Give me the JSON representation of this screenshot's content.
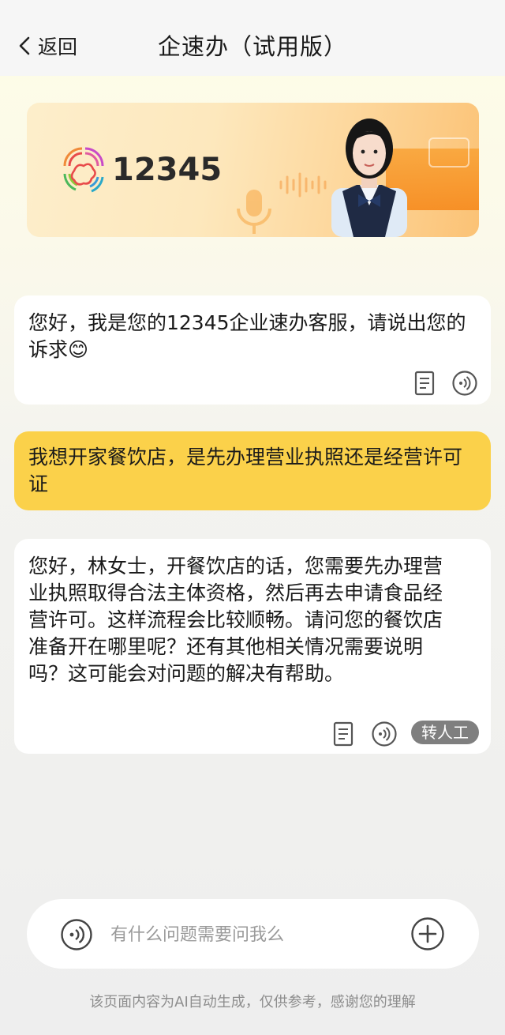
{
  "header": {
    "back_label": "返回",
    "title": "企速办（试用版）"
  },
  "banner": {
    "logo_text": "12345"
  },
  "messages": [
    {
      "role": "bot",
      "text": "您好，我是您的12345企业速办客服，请说出您的诉求😊"
    },
    {
      "role": "user",
      "text": "我想开家餐饮店，是先办理营业执照还是经营许可证"
    },
    {
      "role": "bot",
      "text": "您好，林女士，开餐饮店的话，您需要先办理营业执照取得合法主体资格，然后再去申请食品经营许可。这样流程会比较顺畅。请问您的餐饮店准备开在哪里呢？还有其他相关情况需要说明吗？这可能会对问题的解决有帮助。"
    }
  ],
  "actions": {
    "transfer_label": "转人工"
  },
  "input": {
    "placeholder": "有什么问题需要问我么"
  },
  "footer": {
    "disclaimer": "该页面内容为AI自动生成，仅供参考，感谢您的理解"
  },
  "icons": {
    "back": "chevron-left-icon",
    "copy": "document-icon",
    "speaker": "voice-playback-icon",
    "voice_input": "voice-input-icon",
    "add": "plus-circle-icon"
  },
  "colors": {
    "user_bubble": "#fbd14a",
    "bot_bubble": "#ffffff",
    "transfer_button": "#7f7f7f",
    "banner_orange": "#f68a1d"
  }
}
